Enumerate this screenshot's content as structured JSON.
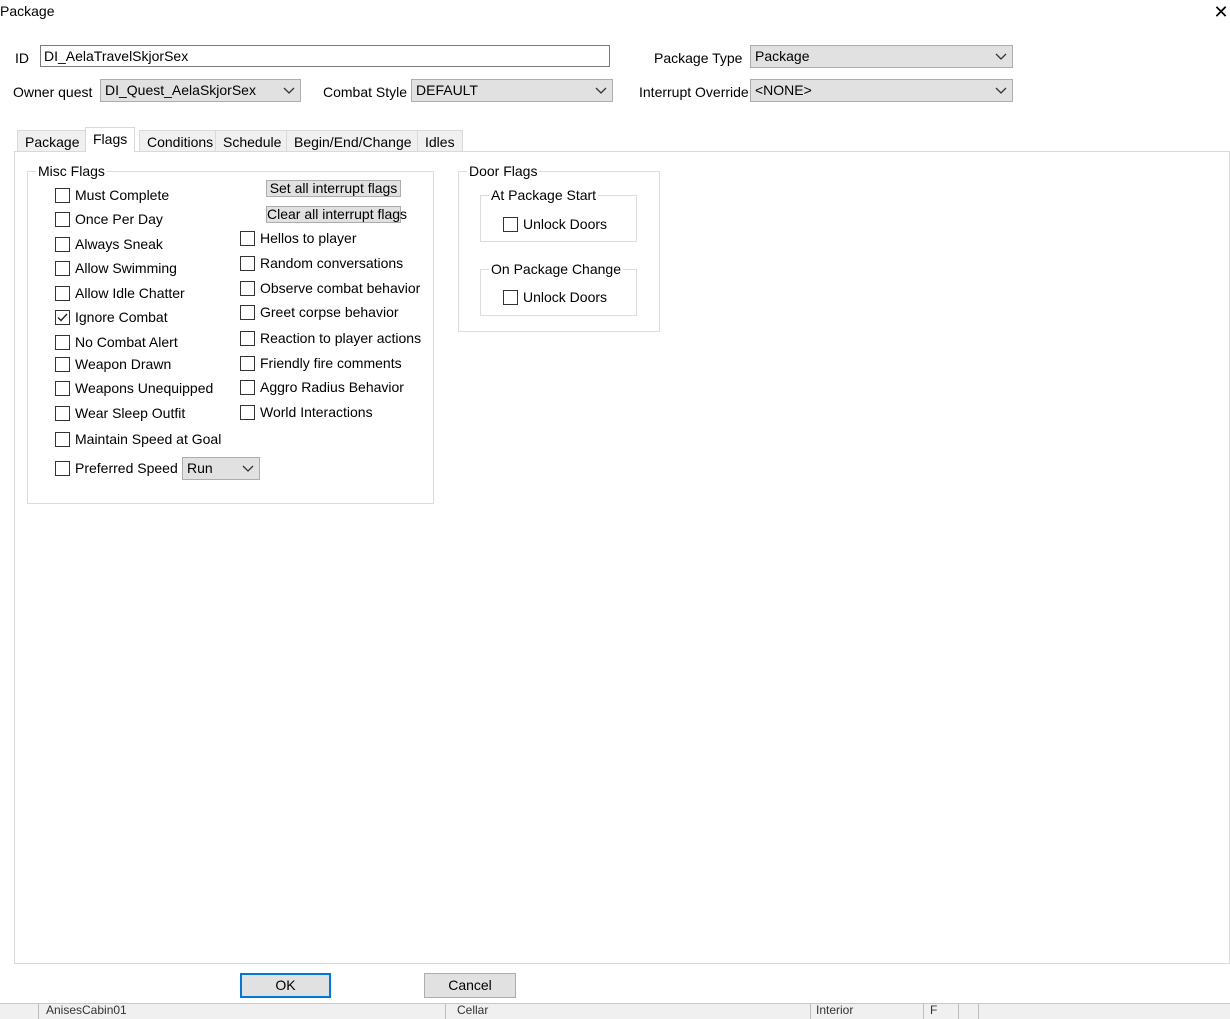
{
  "window": {
    "title": "Package"
  },
  "header": {
    "id_label": "ID",
    "id_value": "DI_AelaTravelSkjorSex",
    "package_type_label": "Package Type",
    "package_type_value": "Package",
    "owner_quest_label": "Owner quest",
    "owner_quest_value": "DI_Quest_AelaSkjorSex",
    "combat_style_label": "Combat Style",
    "combat_style_value": "DEFAULT",
    "interrupt_override_label": "Interrupt Override",
    "interrupt_override_value": "<NONE>"
  },
  "tabs": [
    "Package",
    "Flags",
    "Conditions",
    "Schedule",
    "Begin/End/Change",
    "Idles"
  ],
  "active_tab": "Flags",
  "misc_flags": {
    "title": "Misc Flags",
    "left": [
      {
        "label": "Must Complete",
        "checked": false
      },
      {
        "label": "Once Per Day",
        "checked": false
      },
      {
        "label": "Always Sneak",
        "checked": false
      },
      {
        "label": "Allow Swimming",
        "checked": false
      },
      {
        "label": "Allow Idle Chatter",
        "checked": false
      },
      {
        "label": "Ignore Combat",
        "checked": true
      },
      {
        "label": "No Combat Alert",
        "checked": false
      },
      {
        "label": "Weapon Drawn",
        "checked": false
      },
      {
        "label": "Weapons Unequipped",
        "checked": false
      },
      {
        "label": "Wear Sleep Outfit",
        "checked": false
      },
      {
        "label": "Maintain Speed at Goal",
        "checked": false
      },
      {
        "label": "Preferred Speed",
        "checked": false
      }
    ],
    "preferred_speed_value": "Run",
    "set_all_label": "Set all interrupt flags",
    "clear_all_label": "Clear all interrupt flags",
    "right": [
      {
        "label": "Hellos to player",
        "checked": false
      },
      {
        "label": "Random conversations",
        "checked": false
      },
      {
        "label": "Observe combat behavior",
        "checked": false
      },
      {
        "label": "Greet corpse behavior",
        "checked": false
      },
      {
        "label": "Reaction to player actions",
        "checked": false
      },
      {
        "label": "Friendly fire comments",
        "checked": false
      },
      {
        "label": "Aggro Radius Behavior",
        "checked": false
      },
      {
        "label": "World Interactions",
        "checked": false
      }
    ]
  },
  "door_flags": {
    "title": "Door Flags",
    "at_start_title": "At Package Start",
    "at_start_unlock": {
      "label": "Unlock Doors",
      "checked": false
    },
    "on_change_title": "On Package Change",
    "on_change_unlock": {
      "label": "Unlock Doors",
      "checked": false
    }
  },
  "footer": {
    "ok_label": "OK",
    "cancel_label": "Cancel"
  },
  "background_row": {
    "col1": "AnisesCabin01",
    "col2": "Cellar",
    "col3": "Interior",
    "col4": "F"
  },
  "colors": {
    "focus_border": "#0078d7",
    "button_face": "#e1e1e1",
    "panel_border": "#d9d9d9"
  },
  "icons": {
    "close": "close-icon",
    "dropdown": "chevron-down-icon",
    "check": "check-icon"
  }
}
